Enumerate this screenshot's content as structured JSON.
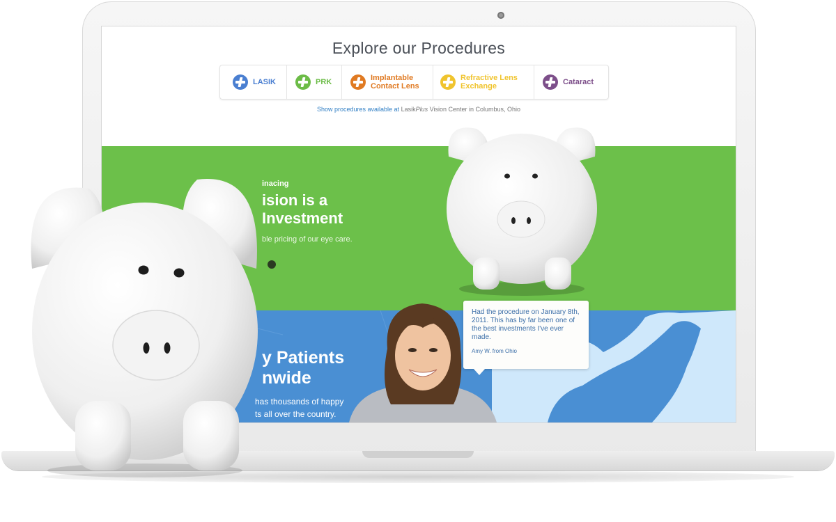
{
  "procedures": {
    "title": "Explore our Procedures",
    "items": [
      {
        "label_line1": "LASIK",
        "label_line2": "",
        "color": "#4a7fd1"
      },
      {
        "label_line1": "PRK",
        "label_line2": "",
        "color": "#6cbc47"
      },
      {
        "label_line1": "Implantable",
        "label_line2": "Contact Lens",
        "color": "#e07a22"
      },
      {
        "label_line1": "Refractive Lens",
        "label_line2": "Exchange",
        "color": "#f0c42e"
      },
      {
        "label_line1": "Cataract",
        "label_line2": "",
        "color": "#7d4f8a"
      }
    ],
    "note_link": "Show procedures available at",
    "note_brand": "Lasik",
    "note_brand_italic": "Plus",
    "note_rest": "Vision Center in Columbus, Ohio"
  },
  "financing": {
    "kicker": "inacing",
    "heading_line1": "ision is a",
    "heading_line2": "Investment",
    "body": "ble pricing of our eye care."
  },
  "patients": {
    "heading_line1": "y Patients",
    "heading_line2": "nwide",
    "body_line1": "has thousands of happy",
    "body_line2": "ts all over the country."
  },
  "testimonial": {
    "quote": "Had the procedure on January 8th, 2011.  This has by far been one of the best investments I've ever made.",
    "author": "Amy W. from Ohio"
  }
}
